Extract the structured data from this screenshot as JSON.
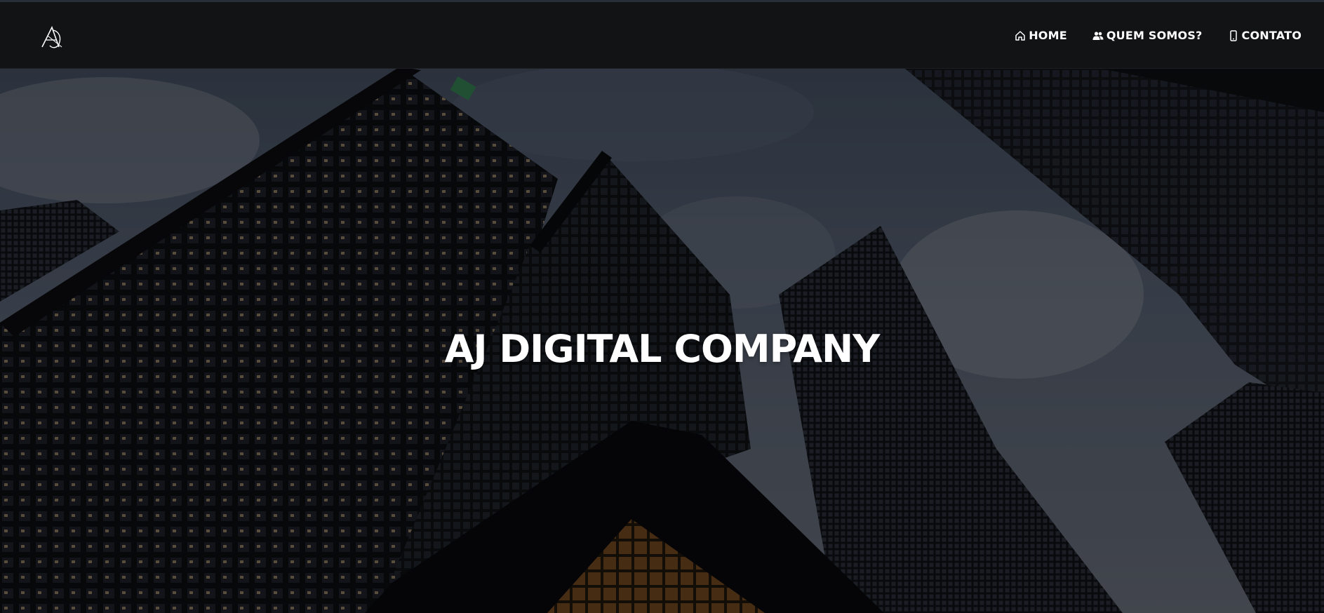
{
  "header": {
    "logo_alt": "AJ",
    "nav": [
      {
        "label": "HOME",
        "icon": "home-icon"
      },
      {
        "label": "QUEM SOMOS?",
        "icon": "users-icon"
      },
      {
        "label": "CONTATO",
        "icon": "phone-icon"
      }
    ]
  },
  "hero": {
    "title": "AJ DIGITAL COMPANY",
    "background": "city-skyscrapers-photo"
  },
  "colors": {
    "topbar": "#121315",
    "text": "#ffffff",
    "sky": "#4d5666",
    "building": "#101216"
  }
}
